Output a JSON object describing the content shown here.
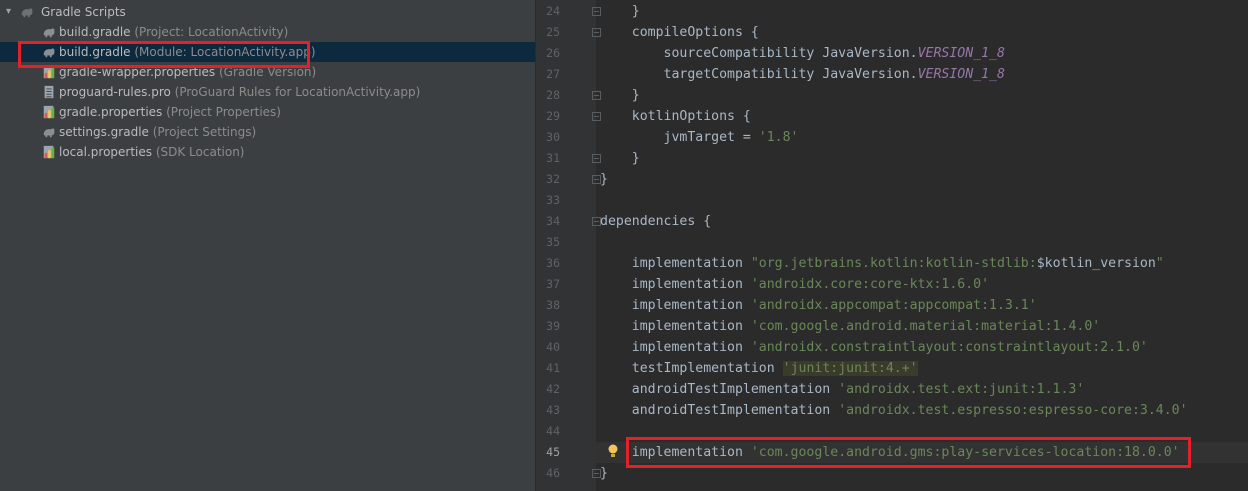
{
  "project_tree": {
    "section_label": "Gradle Scripts",
    "items": [
      {
        "name": "build.gradle",
        "detail": "(Project: LocationActivity)",
        "icon": "gradle-elephant-icon"
      },
      {
        "name": "build.gradle",
        "detail": "(Module: LocationActivity.app)",
        "icon": "gradle-elephant-icon"
      },
      {
        "name": "gradle-wrapper.properties",
        "detail": "(Gradle Version)",
        "icon": "properties-file-icon"
      },
      {
        "name": "proguard-rules.pro",
        "detail": "(ProGuard Rules for LocationActivity.app)",
        "icon": "text-file-icon"
      },
      {
        "name": "gradle.properties",
        "detail": "(Project Properties)",
        "icon": "properties-file-icon"
      },
      {
        "name": "settings.gradle",
        "detail": "(Project Settings)",
        "icon": "gradle-elephant-icon"
      },
      {
        "name": "local.properties",
        "detail": "(SDK Location)",
        "icon": "properties-file-icon"
      }
    ]
  },
  "editor": {
    "current_line": "45",
    "lines": [
      {
        "n": "24",
        "seg": [
          {
            "t": "    }",
            "c": ""
          }
        ]
      },
      {
        "n": "25",
        "seg": [
          {
            "t": "    compileOptions {",
            "c": ""
          }
        ]
      },
      {
        "n": "26",
        "seg": [
          {
            "t": "        sourceCompatibility JavaVersion.",
            "c": ""
          },
          {
            "t": "VERSION_1_8",
            "c": "fld"
          }
        ]
      },
      {
        "n": "27",
        "seg": [
          {
            "t": "        targetCompatibility JavaVersion.",
            "c": ""
          },
          {
            "t": "VERSION_1_8",
            "c": "fld"
          }
        ]
      },
      {
        "n": "28",
        "seg": [
          {
            "t": "    }",
            "c": ""
          }
        ]
      },
      {
        "n": "29",
        "seg": [
          {
            "t": "    kotlinOptions {",
            "c": ""
          }
        ]
      },
      {
        "n": "30",
        "seg": [
          {
            "t": "        jvmTarget = ",
            "c": ""
          },
          {
            "t": "'1.8'",
            "c": "str"
          }
        ]
      },
      {
        "n": "31",
        "seg": [
          {
            "t": "    }",
            "c": ""
          }
        ]
      },
      {
        "n": "32",
        "seg": [
          {
            "t": "}",
            "c": ""
          }
        ]
      },
      {
        "n": "33",
        "seg": []
      },
      {
        "n": "34",
        "seg": [
          {
            "t": "dependencies {",
            "c": ""
          }
        ]
      },
      {
        "n": "35",
        "seg": []
      },
      {
        "n": "36",
        "seg": [
          {
            "t": "    implementation ",
            "c": ""
          },
          {
            "t": "\"org.jetbrains.kotlin:kotlin-stdlib:",
            "c": "str"
          },
          {
            "t": "$kotlin_version",
            "c": ""
          },
          {
            "t": "\"",
            "c": "str"
          }
        ]
      },
      {
        "n": "37",
        "seg": [
          {
            "t": "    implementation ",
            "c": ""
          },
          {
            "t": "'androidx.core:core-ktx:1.6.0'",
            "c": "str"
          }
        ]
      },
      {
        "n": "38",
        "seg": [
          {
            "t": "    implementation ",
            "c": ""
          },
          {
            "t": "'androidx.appcompat:appcompat:1.3.1'",
            "c": "str"
          }
        ]
      },
      {
        "n": "39",
        "seg": [
          {
            "t": "    implementation ",
            "c": ""
          },
          {
            "t": "'com.google.android.material:material:1.4.0'",
            "c": "str"
          }
        ]
      },
      {
        "n": "40",
        "seg": [
          {
            "t": "    implementation ",
            "c": ""
          },
          {
            "t": "'androidx.constraintlayout:constraintlayout:2.1.0'",
            "c": "str"
          }
        ]
      },
      {
        "n": "41",
        "seg": [
          {
            "t": "    testImplementation ",
            "c": ""
          },
          {
            "t": "'junit:junit:4.+'",
            "c": "strhl"
          }
        ]
      },
      {
        "n": "42",
        "seg": [
          {
            "t": "    androidTestImplementation ",
            "c": ""
          },
          {
            "t": "'androidx.test.ext:junit:1.1.3'",
            "c": "str"
          }
        ]
      },
      {
        "n": "43",
        "seg": [
          {
            "t": "    androidTestImplementation ",
            "c": ""
          },
          {
            "t": "'androidx.test.espresso:espresso-core:3.4.0'",
            "c": "str"
          }
        ]
      },
      {
        "n": "44",
        "seg": []
      },
      {
        "n": "45",
        "seg": [
          {
            "t": "    implementation ",
            "c": ""
          },
          {
            "t": "'com.google.android.gms:play-services-location:18.0.0'",
            "c": "str"
          }
        ]
      },
      {
        "n": "46",
        "seg": [
          {
            "t": "}",
            "c": ""
          }
        ]
      }
    ]
  }
}
